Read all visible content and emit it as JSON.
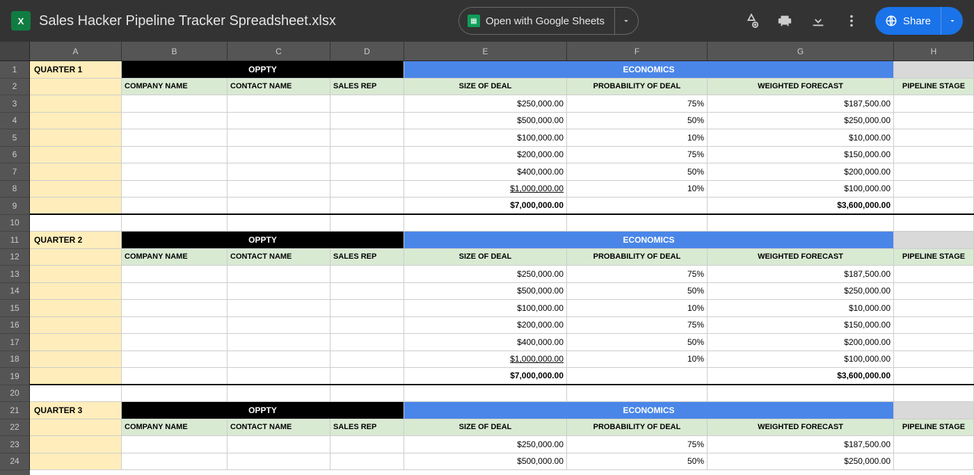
{
  "header": {
    "doc_title": "Sales Hacker Pipeline Tracker Spreadsheet.xlsx",
    "xls_glyph": "X",
    "open_label": "Open with Google Sheets",
    "share_label": "Share"
  },
  "columns": [
    "A",
    "B",
    "C",
    "D",
    "E",
    "F",
    "G",
    "H"
  ],
  "row_numbers": [
    "1",
    "2",
    "3",
    "4",
    "5",
    "6",
    "7",
    "8",
    "9",
    "10",
    "11",
    "12",
    "13",
    "14",
    "15",
    "16",
    "17",
    "18",
    "19",
    "20",
    "21",
    "22",
    "23",
    "24"
  ],
  "section_headers": {
    "oppty": "OPPTY",
    "econ": "ECONOMICS"
  },
  "col_headers": {
    "company": "COMPANY NAME",
    "contact": "CONTACT NAME",
    "rep": "SALES REP",
    "size": "SIZE OF DEAL",
    "prob": "PROBABILITY OF DEAL",
    "forecast": "WEIGHTED FORECAST",
    "stage": "PIPELINE STAGE"
  },
  "quarters": [
    {
      "title": "QUARTER 1",
      "rows": [
        {
          "size": "$250,000.00",
          "prob": "75%",
          "forecast": "$187,500.00"
        },
        {
          "size": "$500,000.00",
          "prob": "50%",
          "forecast": "$250,000.00"
        },
        {
          "size": "$100,000.00",
          "prob": "10%",
          "forecast": "$10,000.00"
        },
        {
          "size": "$200,000.00",
          "prob": "75%",
          "forecast": "$150,000.00"
        },
        {
          "size": "$400,000.00",
          "prob": "50%",
          "forecast": "$200,000.00"
        },
        {
          "size": "$1,000,000.00",
          "prob": "10%",
          "forecast": "$100,000.00"
        }
      ],
      "totals": {
        "size": "$7,000,000.00",
        "forecast": "$3,600,000.00"
      }
    },
    {
      "title": "QUARTER 2",
      "rows": [
        {
          "size": "$250,000.00",
          "prob": "75%",
          "forecast": "$187,500.00"
        },
        {
          "size": "$500,000.00",
          "prob": "50%",
          "forecast": "$250,000.00"
        },
        {
          "size": "$100,000.00",
          "prob": "10%",
          "forecast": "$10,000.00"
        },
        {
          "size": "$200,000.00",
          "prob": "75%",
          "forecast": "$150,000.00"
        },
        {
          "size": "$400,000.00",
          "prob": "50%",
          "forecast": "$200,000.00"
        },
        {
          "size": "$1,000,000.00",
          "prob": "10%",
          "forecast": "$100,000.00"
        }
      ],
      "totals": {
        "size": "$7,000,000.00",
        "forecast": "$3,600,000.00"
      }
    },
    {
      "title": "QUARTER 3",
      "rows": [
        {
          "size": "$250,000.00",
          "prob": "75%",
          "forecast": "$187,500.00"
        },
        {
          "size": "$500,000.00",
          "prob": "50%",
          "forecast": "$250,000.00"
        }
      ],
      "totals": {
        "size": "",
        "forecast": ""
      }
    }
  ]
}
